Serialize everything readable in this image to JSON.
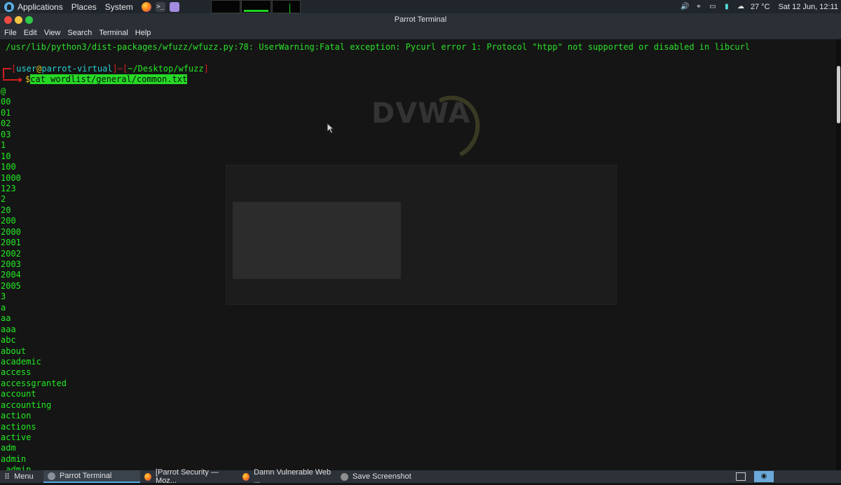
{
  "top_panel": {
    "applications": "Applications",
    "places": "Places",
    "system": "System",
    "temperature": "27 °C",
    "datetime": "Sat 12 Jun, 12:11"
  },
  "window": {
    "title": "Parrot Terminal"
  },
  "menu": [
    "File",
    "Edit",
    "View",
    "Search",
    "Terminal",
    "Help"
  ],
  "terminal": {
    "warning": "/usr/lib/python3/dist-packages/wfuzz/wfuzz.py:78: UserWarning:Fatal exception: Pycurl error 1: Protocol \"htpp\" not supported or disabled in libcurl",
    "prompt_user": "user",
    "prompt_at": "@",
    "prompt_host": "parrot-virtual",
    "prompt_path": "~/Desktop/wfuzz",
    "prompt_symbol": "$",
    "command": "cat wordlist/general/common.txt",
    "output": [
      "@",
      "00",
      "01",
      "02",
      "03",
      "1",
      "10",
      "100",
      "1000",
      "123",
      "2",
      "20",
      "200",
      "2000",
      "2001",
      "2002",
      "2003",
      "2004",
      "2005",
      "3",
      "a",
      "aa",
      "aaa",
      "abc",
      "about",
      "academic",
      "access",
      "accessgranted",
      "account",
      "accounting",
      "action",
      "actions",
      "active",
      "adm",
      "admin",
      "_admin"
    ]
  },
  "taskbar": {
    "menu_label": "Menu",
    "tasks": [
      "Parrot Terminal",
      "[Parrot Security — Moz...",
      "Damn Vulnerable Web ...",
      "Save Screenshot"
    ]
  },
  "colors": {
    "green": "#22e822",
    "red": "#e01e1e",
    "accent": "#5aa9e6"
  }
}
